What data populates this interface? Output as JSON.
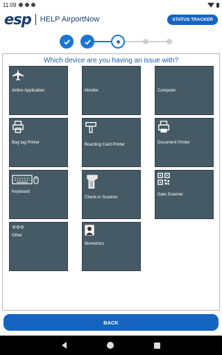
{
  "status_bar": {
    "time": "11:09"
  },
  "header": {
    "logo": "esp",
    "title": "HELP AirportNow",
    "status_tracker_label": "STATUS TRACKER"
  },
  "steps": {
    "total": 5,
    "completed": 2,
    "current": 3
  },
  "main": {
    "question": "Which device are you having an issue with?",
    "tiles": [
      {
        "label": "Airline Application",
        "icon": "airplane-icon"
      },
      {
        "label": "Monitor",
        "icon": "monitor-icon"
      },
      {
        "label": "Computer",
        "icon": "computer-icon"
      },
      {
        "label": "Bag tag Printer",
        "icon": "bag-tag-printer-icon"
      },
      {
        "label": "Boarding Card Printer",
        "icon": "boarding-card-printer-icon"
      },
      {
        "label": "Document Printer",
        "icon": "document-printer-icon"
      },
      {
        "label": "Keyboard",
        "icon": "keyboard-icon"
      },
      {
        "label": "Check-in Scanner",
        "icon": "checkin-scanner-icon"
      },
      {
        "label": "Gate Scanner",
        "icon": "qr-code-icon"
      },
      {
        "label": "Other",
        "icon": "ellipsis-icon"
      },
      {
        "label": "Biometrics",
        "icon": "biometrics-icon"
      }
    ]
  },
  "footer": {
    "back_label": "BACK"
  },
  "colors": {
    "brand": "#1b3e6e",
    "accent": "#1565c0",
    "tile": "#455a64"
  }
}
